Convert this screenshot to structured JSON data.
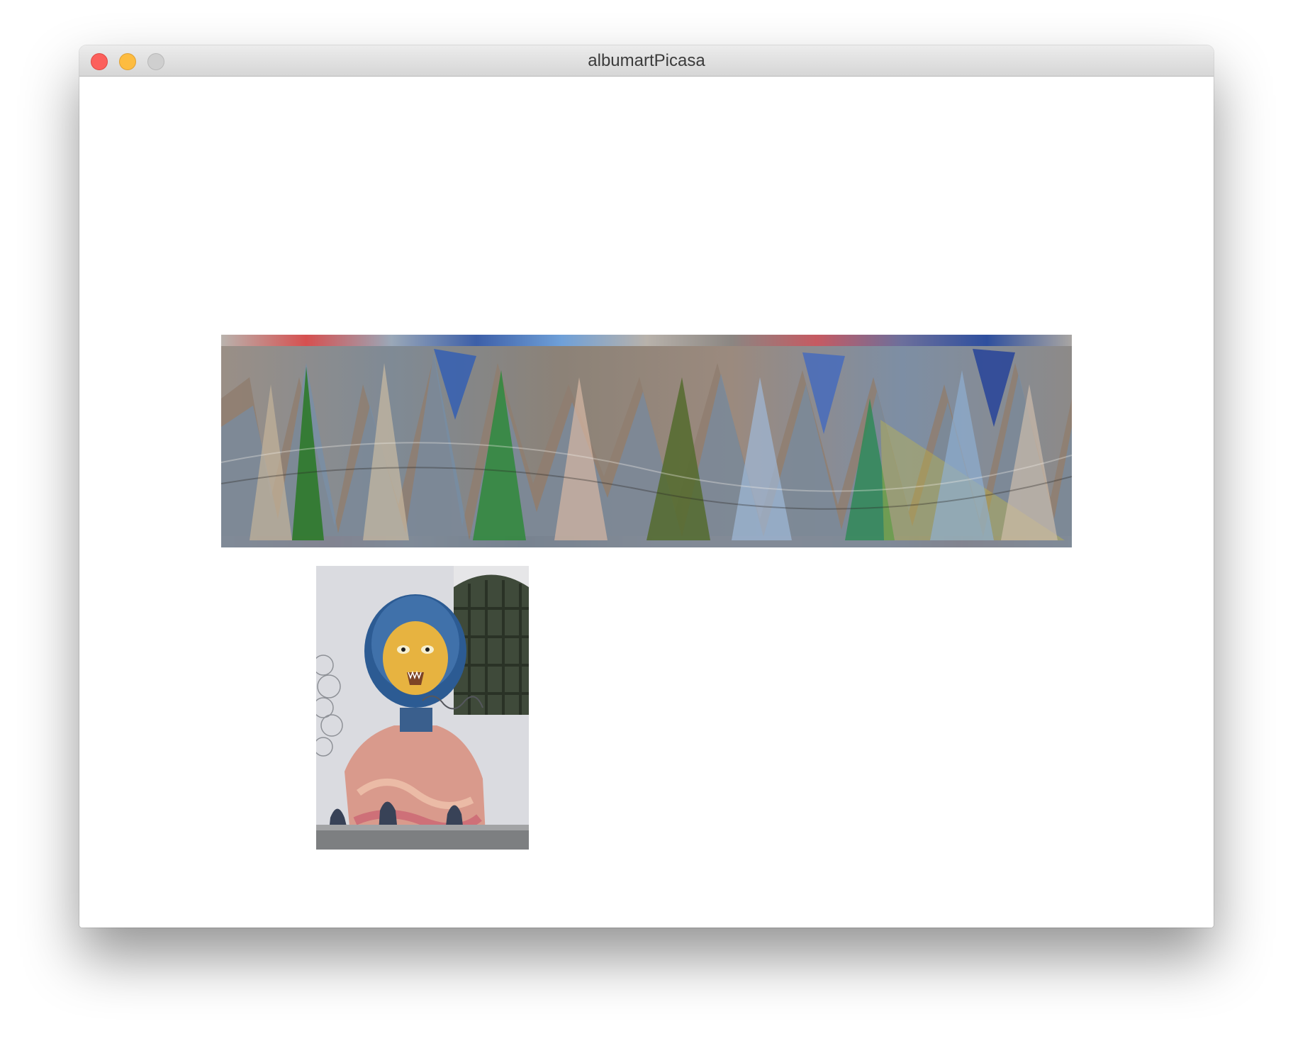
{
  "window": {
    "title": "albumartPicasa"
  },
  "images": {
    "banner": {
      "description_icon": "distorted-album-art-image"
    },
    "photo": {
      "description_icon": "graffiti-portrait-photo"
    }
  }
}
